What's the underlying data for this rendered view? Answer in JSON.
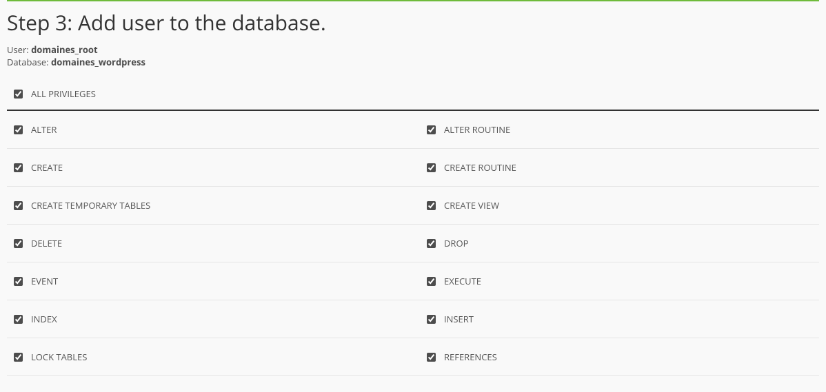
{
  "step_title": "Step 3: Add user to the database.",
  "meta": {
    "user_label": "User: ",
    "user_value": "domaines_root",
    "db_label": "Database: ",
    "db_value": "domaines_wordpress"
  },
  "all_privileges": {
    "label": "ALL PRIVILEGES",
    "checked": true
  },
  "privileges": [
    {
      "left": {
        "label": "ALTER",
        "checked": true
      },
      "right": {
        "label": "ALTER ROUTINE",
        "checked": true
      }
    },
    {
      "left": {
        "label": "CREATE",
        "checked": true
      },
      "right": {
        "label": "CREATE ROUTINE",
        "checked": true
      }
    },
    {
      "left": {
        "label": "CREATE TEMPORARY TABLES",
        "checked": true
      },
      "right": {
        "label": "CREATE VIEW",
        "checked": true
      }
    },
    {
      "left": {
        "label": "DELETE",
        "checked": true
      },
      "right": {
        "label": "DROP",
        "checked": true
      }
    },
    {
      "left": {
        "label": "EVENT",
        "checked": true
      },
      "right": {
        "label": "EXECUTE",
        "checked": true
      }
    },
    {
      "left": {
        "label": "INDEX",
        "checked": true
      },
      "right": {
        "label": "INSERT",
        "checked": true
      }
    },
    {
      "left": {
        "label": "LOCK TABLES",
        "checked": true
      },
      "right": {
        "label": "REFERENCES",
        "checked": true
      }
    }
  ]
}
